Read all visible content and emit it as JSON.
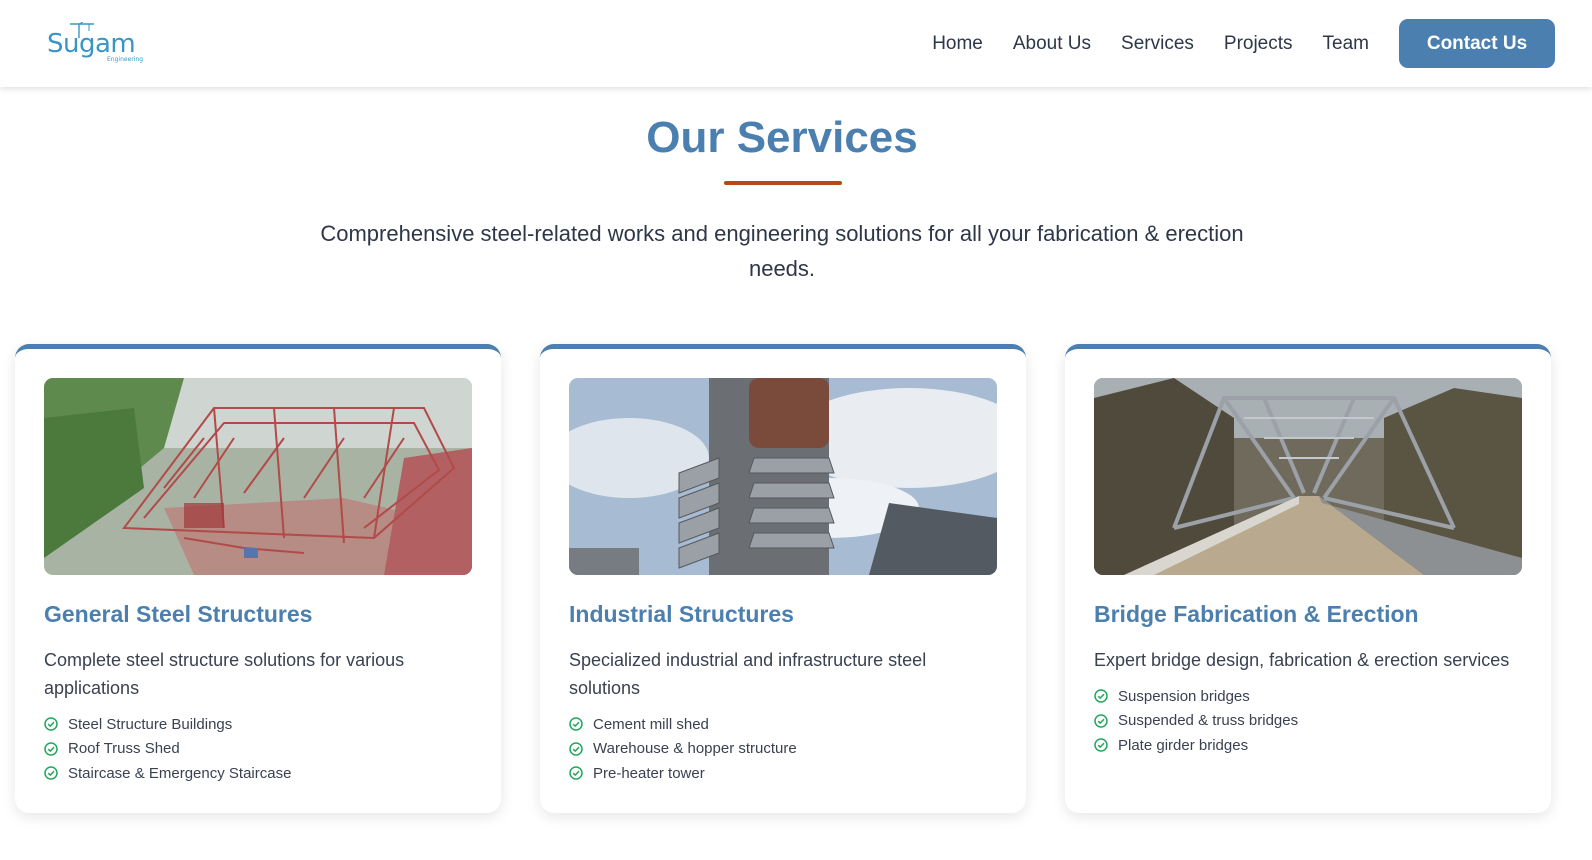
{
  "brand": {
    "logo_text": "Sugam",
    "logo_sub": "Engineering"
  },
  "nav": {
    "items": [
      {
        "label": "Home"
      },
      {
        "label": "About Us"
      },
      {
        "label": "Services"
      },
      {
        "label": "Projects"
      },
      {
        "label": "Team"
      }
    ],
    "cta_label": "Contact Us"
  },
  "section": {
    "title": "Our Services",
    "subtitle": "Comprehensive steel-related works and engineering solutions for all your fabrication & erection needs."
  },
  "services": [
    {
      "title": "General Steel Structures",
      "description": "Complete steel structure solutions for various applications",
      "image": "steel-truss-roof-construction-photo",
      "features": [
        "Steel Structure Buildings",
        "Roof Truss Shed",
        "Staircase & Emergency Staircase"
      ]
    },
    {
      "title": "Industrial Structures",
      "description": "Specialized industrial and infrastructure steel solutions",
      "image": "industrial-preheater-tower-photo",
      "features": [
        "Cement mill shed",
        "Warehouse & hopper structure",
        "Pre-heater tower"
      ]
    },
    {
      "title": "Bridge Fabrication & Erection",
      "description": "Expert bridge design, fabrication & erection services",
      "image": "steel-truss-bridge-photo",
      "features": [
        "Suspension bridges",
        "Suspended & truss bridges",
        "Plate girder bridges"
      ]
    }
  ],
  "colors": {
    "accent": "#4a7fb0",
    "rule": "#b8481a",
    "check": "#22a85a",
    "text": "#2d3748"
  }
}
